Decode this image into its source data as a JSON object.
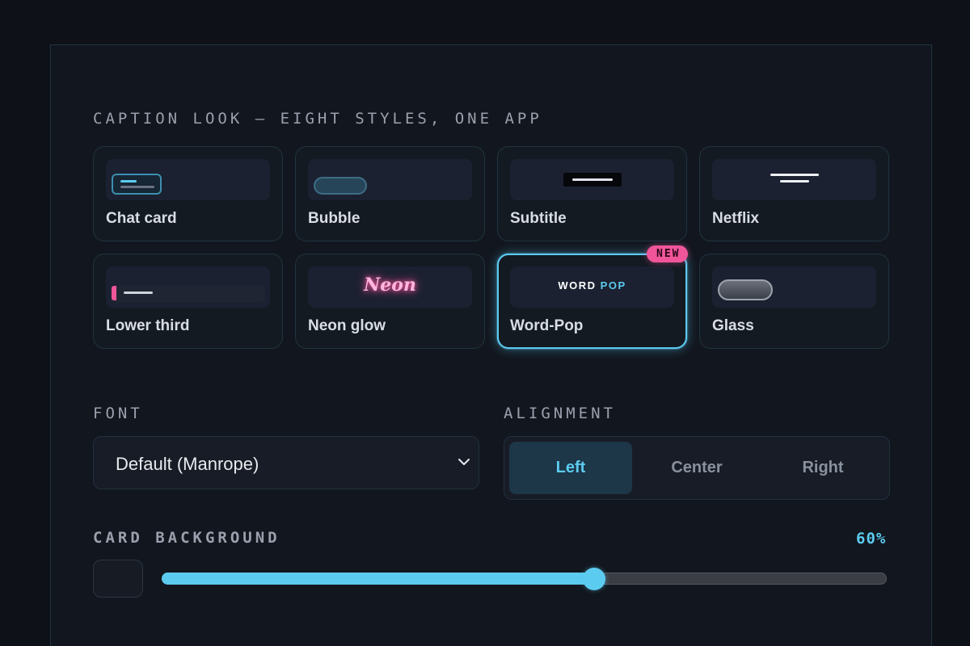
{
  "caption_look": {
    "heading": "CAPTION LOOK — EIGHT STYLES, ONE APP",
    "styles": [
      {
        "name": "Chat card",
        "preview": "chat-card"
      },
      {
        "name": "Bubble",
        "preview": "bubble"
      },
      {
        "name": "Subtitle",
        "preview": "subtitle"
      },
      {
        "name": "Netflix",
        "preview": "netflix"
      },
      {
        "name": "Lower third",
        "preview": "lower-third"
      },
      {
        "name": "Neon glow",
        "preview": "neon",
        "preview_text": "Neon"
      },
      {
        "name": "Word-Pop",
        "preview": "word-pop",
        "preview_text_1": "WORD",
        "preview_text_2": "POP",
        "badge": "NEW",
        "selected": true
      },
      {
        "name": "Glass",
        "preview": "glass"
      }
    ]
  },
  "font": {
    "label": "FONT",
    "value": "Default (Manrope)",
    "icon": "chevron-down-icon"
  },
  "alignment": {
    "label": "ALIGNMENT",
    "options": [
      "Left",
      "Center",
      "Right"
    ],
    "selected": "Left"
  },
  "card_background": {
    "label": "CARD BACKGROUND",
    "percent_label": "60%",
    "value": 0.6
  },
  "colors": {
    "accent": "#5ccbf0",
    "badge": "#f0559a",
    "background": "#0e1118",
    "panel": "#12161e"
  }
}
